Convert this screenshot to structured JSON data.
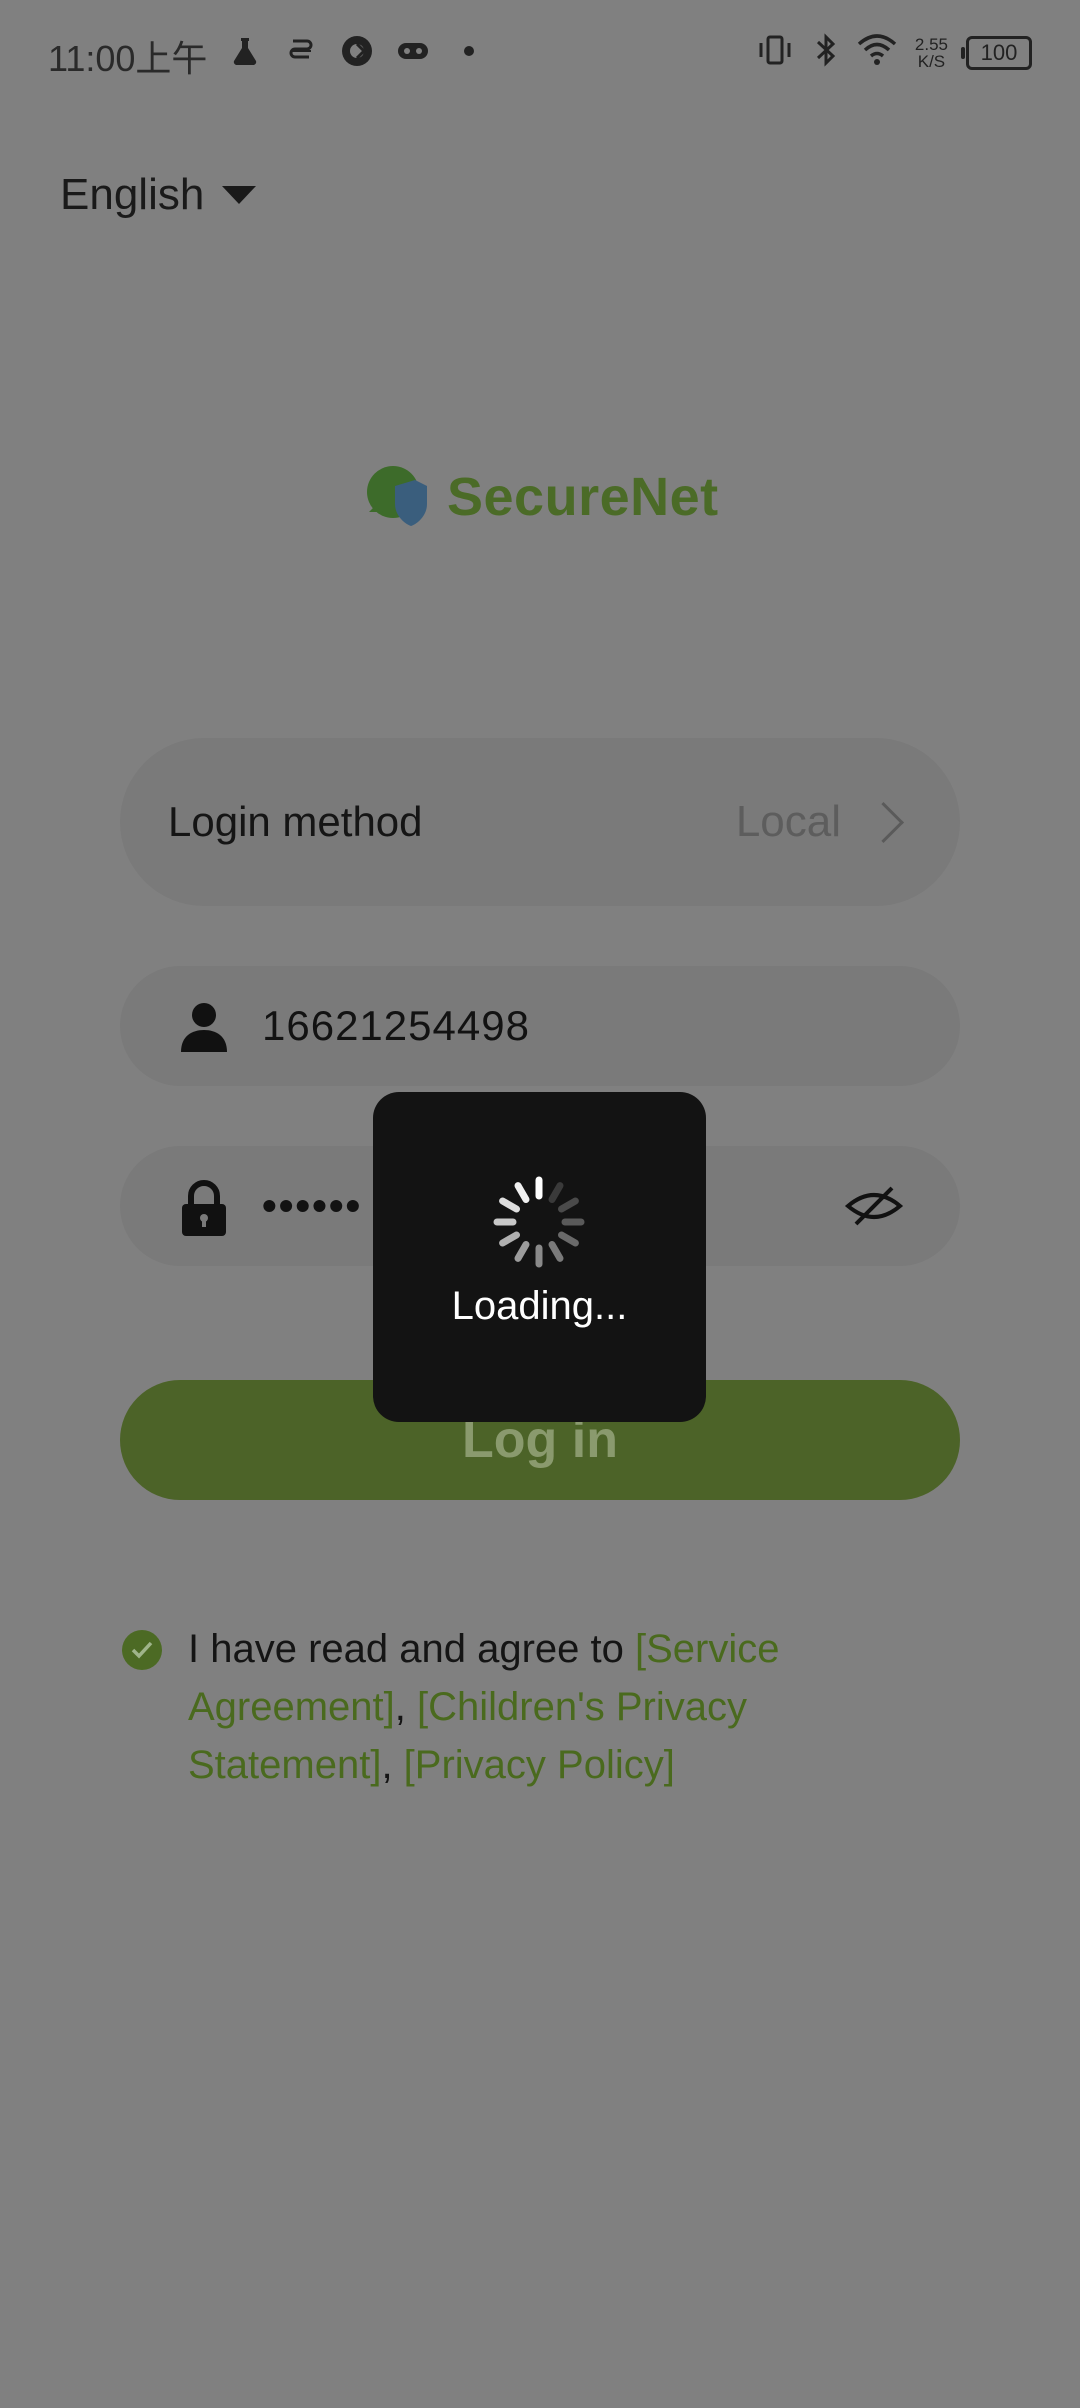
{
  "status_bar": {
    "time": "11:00上午",
    "net_speed_value": "2.55",
    "net_speed_unit": "K/S",
    "battery": "100",
    "left_icons": [
      "flask-icon",
      "swirl-app-icon",
      "camera-app-icon",
      "gamepad-icon",
      "dot-icon"
    ],
    "right_icons": [
      "vibrate-icon",
      "bluetooth-icon",
      "wifi-icon",
      "battery-icon"
    ]
  },
  "language": {
    "label": "English"
  },
  "brand": {
    "name": "SecureNet",
    "color": "#4b6b27"
  },
  "login_method": {
    "label": "Login method",
    "value": "Local"
  },
  "username": {
    "value": "16621254498"
  },
  "password": {
    "masked_value": "••••••"
  },
  "login_button": {
    "label": "Log in",
    "color": "#4c6328"
  },
  "agreement": {
    "prefix": "I have read and agree to ",
    "service": "[Service Agreement]",
    "children": "[Children's Privacy Statement]",
    "privacy": "[Privacy Policy]",
    "sep": ", "
  },
  "loading": {
    "text": "Loading..."
  }
}
